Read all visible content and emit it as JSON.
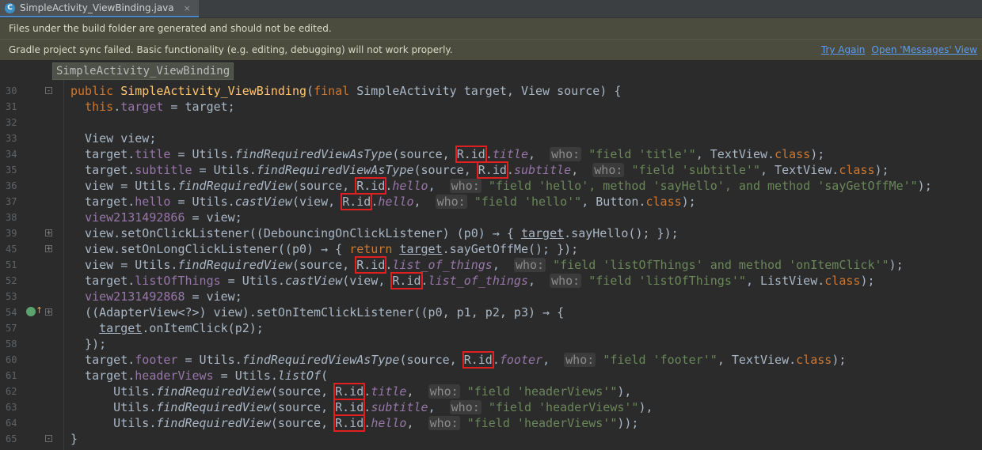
{
  "tab": {
    "title": "SimpleActivity_ViewBinding.java",
    "close_symbol": "×",
    "icon_letter": "C"
  },
  "banner_generated": {
    "message": "Files under the build folder are generated and should not be edited."
  },
  "banner_gradle": {
    "message": "Gradle project sync failed. Basic functionality (e.g. editing, debugging) will not work properly.",
    "try_again": "Try Again",
    "open_messages": "Open 'Messages' View"
  },
  "breadcrumb": {
    "label": "SimpleActivity_ViewBinding"
  },
  "editor": {
    "line_numbers": [
      "30",
      "31",
      "32",
      "33",
      "34",
      "35",
      "36",
      "37",
      "38",
      "39",
      "45",
      "51",
      "52",
      "53",
      "54",
      "57",
      "58",
      "60",
      "61",
      "62",
      "63",
      "64",
      "65"
    ],
    "lines": [
      "public SimpleActivity_ViewBinding(final SimpleActivity target, View source) {",
      "  this.target = target;",
      "",
      "  View view;",
      "  target.title = Utils.findRequiredViewAsType(source, R.id.title,  who: \"field 'title'\", TextView.class);",
      "  target.subtitle = Utils.findRequiredViewAsType(source, R.id.subtitle,  who: \"field 'subtitle'\", TextView.class);",
      "  view = Utils.findRequiredView(source, R.id.hello,  who: \"field 'hello', method 'sayHello', and method 'sayGetOffMe'\");",
      "  target.hello = Utils.castView(view, R.id.hello,  who: \"field 'hello'\", Button.class);",
      "  view2131492866 = view;",
      "  view.setOnClickListener((DebouncingOnClickListener) (p0) → { target.sayHello(); });",
      "  view.setOnLongClickListener((p0) → { return target.sayGetOffMe(); });",
      "  view = Utils.findRequiredView(source, R.id.list_of_things,  who: \"field 'listOfThings' and method 'onItemClick'\");",
      "  target.listOfThings = Utils.castView(view, R.id.list_of_things,  who: \"field 'listOfThings'\", ListView.class);",
      "  view2131492868 = view;",
      "  ((AdapterView<?>) view).setOnItemClickListener((p0, p1, p2, p3) → {",
      "    target.onItemClick(p2);",
      "  });",
      "  target.footer = Utils.findRequiredViewAsType(source, R.id.footer,  who: \"field 'footer'\", TextView.class);",
      "  target.headerViews = Utils.listOf(",
      "      Utils.findRequiredView(source, R.id.title,  who: \"field 'headerViews'\"),",
      "      Utils.findRequiredView(source, R.id.subtitle,  who: \"field 'headerViews'\"),",
      "      Utils.findRequiredView(source, R.id.hello,  who: \"field 'headerViews'\"));",
      "}"
    ]
  },
  "colors": {
    "background": "#2b2b2b",
    "keyword": "#cc7832",
    "field": "#9876aa",
    "string": "#6a8759",
    "method_decl": "#ffc66d",
    "highlight_box": "#e02020",
    "banner": "#4b4b3e",
    "link": "#589df6"
  }
}
